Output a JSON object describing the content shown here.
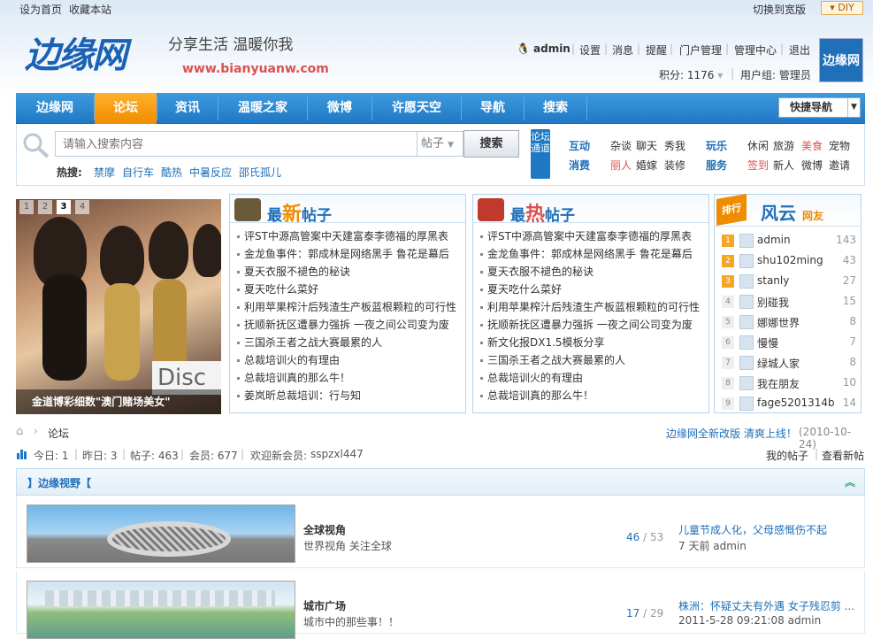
{
  "topbar": {
    "set_home": "设为首页",
    "bookmark": "收藏本站",
    "switch_wide": "切换到宽版",
    "diy": "DIY"
  },
  "logo": {
    "name": "边缘网",
    "slogan": "分享生活   温暖你我",
    "url": "www.bianyuanw.com"
  },
  "user": {
    "name": "admin",
    "links": [
      "设置",
      "消息",
      "提醒",
      "门户管理",
      "管理中心",
      "退出"
    ],
    "points": "积分: 1176",
    "group": "用户组: 管理员",
    "avatar_text": "边缘网"
  },
  "nav": {
    "items": [
      "边缘网",
      "论坛",
      "资讯",
      "温暖之家",
      "微博",
      "许愿天空",
      "导航",
      "搜索"
    ],
    "active": 1,
    "quick": "快捷导航"
  },
  "search": {
    "placeholder": "请输入搜索内容",
    "type": "帖子",
    "button": "搜索",
    "hot_label": "热搜:",
    "hot": [
      "禁摩",
      "自行车",
      "酷热",
      "中暑反应",
      "邵氏孤儿"
    ]
  },
  "forum_channel": {
    "tab": "论坛通道",
    "row1": [
      "互动",
      "杂谈",
      "聊天",
      "秀我",
      "玩乐",
      "休闲",
      "旅游",
      "美食",
      "宠物"
    ],
    "row2": [
      "消费",
      "丽人",
      "婚嫁",
      "装修",
      "服务",
      "签到",
      "新人",
      "微博",
      "邀请"
    ]
  },
  "slide": {
    "numbers": [
      "1",
      "2",
      "3",
      "4"
    ],
    "active": 2,
    "caption": "金道博彩细数\"澳门赌场美女\"",
    "overlay": "Disc"
  },
  "newest": {
    "title_a": "最",
    "title_b": "新",
    "title_c": "帖子",
    "items": [
      "评ST中源高管案中天建富泰李德福的厚黑表",
      "金龙鱼事件：郭成林是网络黑手 鲁花是幕后",
      "夏天衣服不褪色的秘诀",
      "夏天吃什么菜好",
      "利用苹果榨汁后残渣生产板蓝根颗粒的可行性",
      "抚顺新抚区遭暴力强拆 一夜之间公司变为废",
      "三国杀王者之战大赛最累的人",
      "总裁培训火的有理由",
      "总裁培训真的那么牛！",
      "姜岚昕总裁培训：行与知"
    ]
  },
  "hottest": {
    "title_a": "最",
    "title_b": "热",
    "title_c": "帖子",
    "items": [
      "评ST中源高管案中天建富泰李德福的厚黑表",
      "金龙鱼事件：郭成林是网络黑手 鲁花是幕后",
      "夏天衣服不褪色的秘诀",
      "夏天吃什么菜好",
      "利用苹果榨汁后残渣生产板蓝根颗粒的可行性",
      "抚顺新抚区遭暴力强拆 一夜之间公司变为废",
      "新文化报DX1.5模板分享",
      "三国杀王者之战大赛最累的人",
      "总裁培训火的有理由",
      "总裁培训真的那么牛！"
    ]
  },
  "rank": {
    "tag": "排行",
    "title": "风云",
    "sub": "网友",
    "users": [
      {
        "n": "1",
        "name": "admin",
        "score": "143"
      },
      {
        "n": "2",
        "name": "shu102ming",
        "score": "43"
      },
      {
        "n": "3",
        "name": "stanly",
        "score": "27"
      },
      {
        "n": "4",
        "name": "别碰我",
        "score": "15"
      },
      {
        "n": "5",
        "name": "娜娜世界",
        "score": "8"
      },
      {
        "n": "6",
        "name": "慢慢",
        "score": "7"
      },
      {
        "n": "7",
        "name": "绿城人家",
        "score": "8"
      },
      {
        "n": "8",
        "name": "我在朋友",
        "score": "10"
      },
      {
        "n": "9",
        "name": "fage5201314b",
        "score": "14"
      }
    ]
  },
  "breadcrumb": {
    "current": "论坛",
    "notice": "边缘网全新改版 清爽上线！",
    "notice_date": "(2010-10-24)"
  },
  "stats": {
    "today": "今日: 1",
    "yesterday": "昨日: 3",
    "posts": "帖子: 463",
    "members": "会员: 677",
    "newest_label": "欢迎新会员:",
    "newest_member": "sspzxl447",
    "my_posts": "我的帖子",
    "view_new": "查看新帖"
  },
  "section": {
    "title": "】边缘视野【"
  },
  "forums": [
    {
      "name": "全球视角",
      "desc": "世界视角 关注全球",
      "threads": "46",
      "posts": "53",
      "last_title": "儿童节成人化，父母感慨伤不起",
      "last_meta": "7 天前 admin"
    },
    {
      "name": "城市广场",
      "desc": "城市中的那些事！！",
      "threads": "17",
      "posts": "29",
      "last_title": "株洲：怀疑丈夫有外遇 女子残忍剪 ...",
      "last_meta": "2011-5-28 09:21:08 admin"
    }
  ],
  "colors": {
    "nav_blue": "#1f78c4",
    "nav_active": "#f08c00",
    "link": "#1f6fb9"
  }
}
